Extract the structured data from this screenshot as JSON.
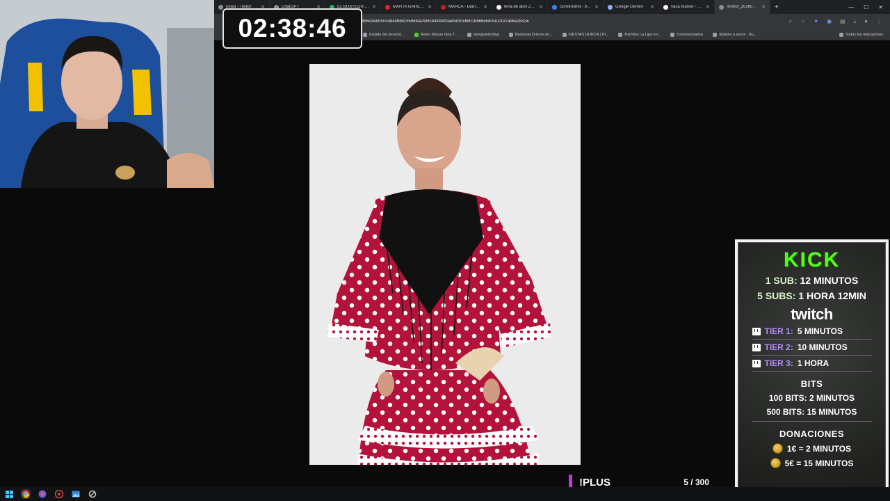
{
  "browser": {
    "tabs": [
      {
        "label": "ncla3 - Twitch",
        "active": false
      },
      {
        "label": "ChatGPT",
        "active": false
      },
      {
        "label": "EL BUSTEON 2.0",
        "active": false
      },
      {
        "label": "MARTA GARCIA H...",
        "active": false
      },
      {
        "label": "MARCA - Diario on...",
        "active": false
      },
      {
        "label": "feria de abril 2026",
        "active": false
      },
      {
        "label": "Screenshot - 8E9KF",
        "active": false
      },
      {
        "label": "Google Gemini",
        "active": false
      },
      {
        "label": "vaca marvel - Busca",
        "active": false
      },
      {
        "label": "InShot_20260301_2...",
        "active": true
      }
    ],
    "url": "4b5818&hm=fa84468b155f6dda295fc84fdf49f3ad5930c6801b866e5d0ce1f197ab6a2832&",
    "bookmarks": [
      "Estado del servicio...",
      "Razer Mouse Grip T...",
      "elangulotv.blog",
      "Backseat Drivers en...",
      "FIESTAS GURCA | Di...",
      "Partidos La Liga en...",
      "Concesionarios",
      "dolares a euros - Bu..."
    ],
    "all_bookmarks": "Todos los marcadores"
  },
  "timer": {
    "value": "02:38:46"
  },
  "photo": {
    "dress_color": "#b3123a",
    "dot_color": "#ffffff"
  },
  "panel": {
    "kick_title": "KICK",
    "kick_lines": [
      {
        "prefix": "1 SUB:",
        "value": "12 MINUTOS"
      },
      {
        "prefix": "5 SUBS:",
        "value": "1 HORA 12MIN"
      }
    ],
    "twitch_title": "twitch",
    "tiers": [
      {
        "tier": "TIER 1:",
        "value": "5 MINUTOS"
      },
      {
        "tier": "TIER 2:",
        "value": "10 MINUTOS"
      },
      {
        "tier": "TIER 3:",
        "value": "1 HORA"
      }
    ],
    "bits_title": "BITS",
    "bits": [
      "100 BITS: 2 MINUTOS",
      "500 BITS: 15 MINUTOS"
    ],
    "donations_title": "DONACIONES",
    "donations": [
      "1€ = 2 MINUTOS",
      "5€ = 15 MINUTOS"
    ]
  },
  "plus": {
    "label": "!PLUS",
    "count": "5 / 300",
    "accent": "#c03ad8"
  },
  "colors": {
    "kick_green": "#53fc18",
    "tier_purple": "#b48cf0"
  }
}
